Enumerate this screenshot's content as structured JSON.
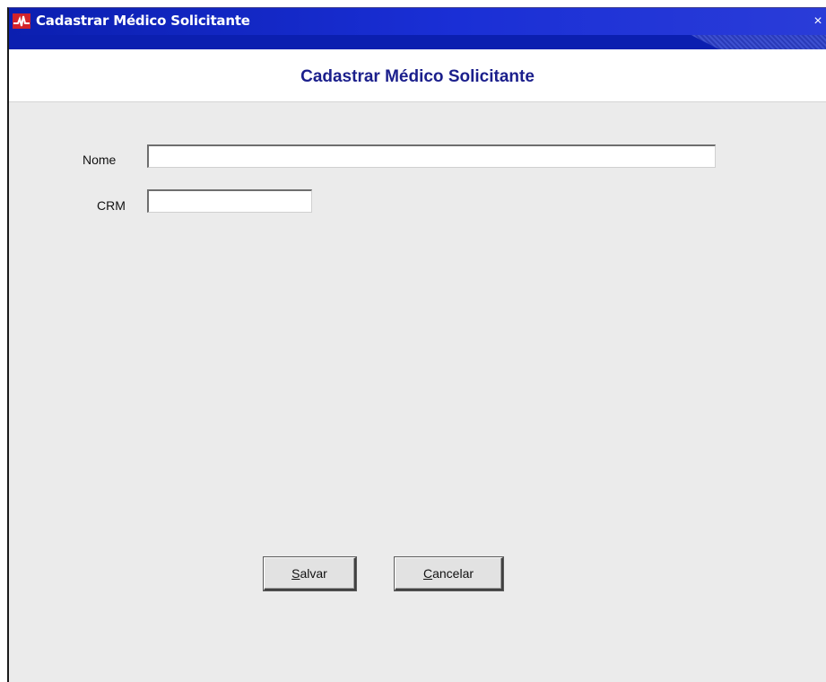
{
  "window": {
    "title": "Cadastrar Médico Solicitante",
    "close_glyph": "×",
    "app_icon": "heartbeat-icon",
    "accent_color": "#0b1fb0",
    "icon_color": "#d2232a"
  },
  "header": {
    "title": "Cadastrar Médico Solicitante",
    "title_color": "#1b1f8c"
  },
  "form": {
    "nome": {
      "label": "Nome",
      "value": "",
      "placeholder": ""
    },
    "crm": {
      "label": "CRM",
      "value": "",
      "placeholder": ""
    }
  },
  "buttons": {
    "save": {
      "mnemonic": "S",
      "rest": "alvar"
    },
    "cancel": {
      "mnemonic": "C",
      "rest": "ancelar"
    }
  }
}
